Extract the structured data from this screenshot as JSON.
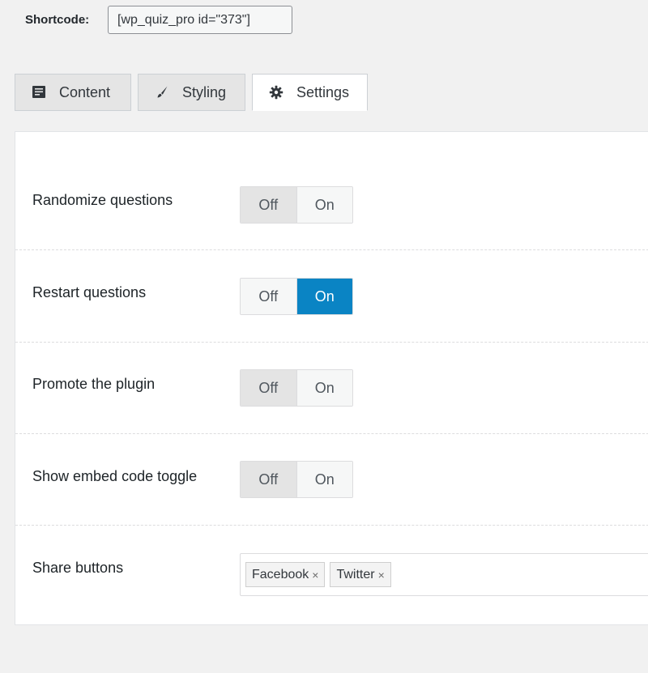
{
  "shortcode": {
    "label": "Shortcode:",
    "value": "[wp_quiz_pro id=\"373\"]"
  },
  "tabs": [
    {
      "label": "Content",
      "icon": "document-icon",
      "active": false
    },
    {
      "label": "Styling",
      "icon": "brush-icon",
      "active": false
    },
    {
      "label": "Settings",
      "icon": "gear-icon",
      "active": true
    }
  ],
  "settings": {
    "randomize_questions": {
      "label": "Randomize questions",
      "off_label": "Off",
      "on_label": "On",
      "value": "Off"
    },
    "restart_questions": {
      "label": "Restart questions",
      "off_label": "Off",
      "on_label": "On",
      "value": "On"
    },
    "promote_plugin": {
      "label": "Promote the plugin",
      "off_label": "Off",
      "on_label": "On",
      "value": "Off"
    },
    "show_embed_code": {
      "label": "Show embed code toggle",
      "off_label": "Off",
      "on_label": "On",
      "value": "Off"
    },
    "share_buttons": {
      "label": "Share buttons",
      "tags": [
        "Facebook",
        "Twitter"
      ],
      "remove_glyph": "×"
    }
  },
  "colors": {
    "accent": "#0a84c4",
    "selected_off": "#e4e4e4"
  }
}
